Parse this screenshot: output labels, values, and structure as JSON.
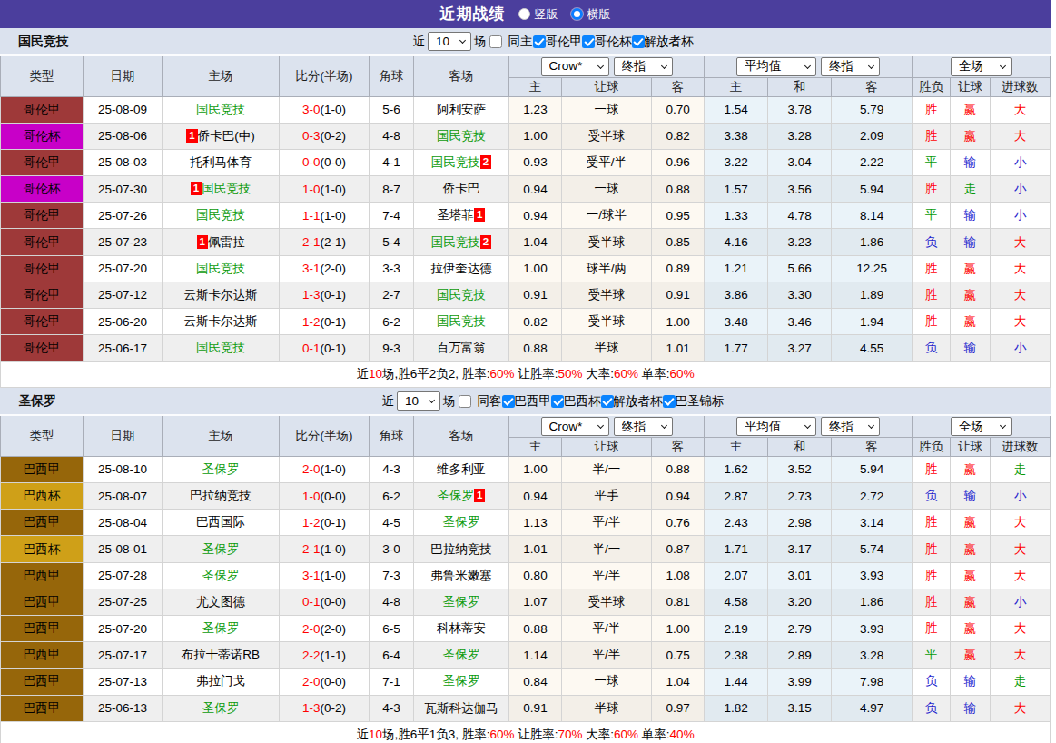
{
  "topbar": {
    "title": "近期战绩",
    "radios": [
      {
        "label": "竖版",
        "selected": false
      },
      {
        "label": "横版",
        "selected": true
      }
    ]
  },
  "columns": {
    "main": [
      "类型",
      "日期",
      "主场",
      "比分(半场)",
      "角球",
      "客场"
    ],
    "sub": [
      "主",
      "让球",
      "客",
      "主",
      "和",
      "客",
      "胜负",
      "让球",
      "进球数"
    ]
  },
  "league_colors": {
    "哥伦甲": "#9e3939",
    "哥伦杯": "#c800c8",
    "巴西甲": "#96660a",
    "巴西杯": "#cfa018"
  },
  "result_colors": {
    "胜": "res-r",
    "平": "res-g",
    "负": "res-b",
    "赢": "res-r",
    "走": "res-g",
    "输": "res-b",
    "大": "res-r",
    "小": "res-b"
  },
  "sections": [
    {
      "team": "国民竞技",
      "controls": {
        "recent_label": "近",
        "recent_value": "10",
        "games_label": "场",
        "same_label": "同主",
        "same_checked": false,
        "leagues": [
          {
            "label": "哥伦甲",
            "checked": true
          },
          {
            "label": "哥伦杯",
            "checked": true
          },
          {
            "label": "解放者杯",
            "checked": true
          }
        ]
      },
      "selects": {
        "odds_company": "Crow*",
        "odds_stage": "终指",
        "average": "平均值",
        "average_stage": "终指",
        "scope": "全场"
      },
      "rows": [
        {
          "league": "哥伦甲",
          "date": "25-08-09",
          "home": {
            "name": "国民竞技",
            "self": true,
            "badge": ""
          },
          "score": "3-0",
          "half": "(1-0)",
          "corner": "5-6",
          "away": {
            "name": "阿利安萨",
            "self": false,
            "badge": ""
          },
          "odds": [
            "1.23",
            "一球",
            "0.70"
          ],
          "avg": [
            "1.54",
            "3.78",
            "5.79"
          ],
          "results": [
            "胜",
            "赢",
            "大"
          ]
        },
        {
          "league": "哥伦杯",
          "date": "25-08-06",
          "home": {
            "name": "侨卡巴(中)",
            "self": false,
            "badge": "1"
          },
          "score": "0-3",
          "half": "(0-2)",
          "corner": "4-8",
          "away": {
            "name": "国民竞技",
            "self": true,
            "badge": ""
          },
          "odds": [
            "1.00",
            "受半球",
            "0.82"
          ],
          "avg": [
            "3.38",
            "3.28",
            "2.09"
          ],
          "results": [
            "胜",
            "赢",
            "大"
          ]
        },
        {
          "league": "哥伦甲",
          "date": "25-08-03",
          "home": {
            "name": "托利马体育",
            "self": false,
            "badge": ""
          },
          "score": "0-0",
          "half": "(0-0)",
          "corner": "4-1",
          "away": {
            "name": "国民竞技",
            "self": true,
            "badge": "2"
          },
          "odds": [
            "0.93",
            "受平/半",
            "0.96"
          ],
          "avg": [
            "3.22",
            "3.04",
            "2.22"
          ],
          "results": [
            "平",
            "输",
            "小"
          ]
        },
        {
          "league": "哥伦杯",
          "date": "25-07-30",
          "home": {
            "name": "国民竞技",
            "self": true,
            "badge": "1"
          },
          "score": "1-0",
          "half": "(1-0)",
          "corner": "8-7",
          "away": {
            "name": "侨卡巴",
            "self": false,
            "badge": ""
          },
          "odds": [
            "0.94",
            "一球",
            "0.88"
          ],
          "avg": [
            "1.57",
            "3.56",
            "5.94"
          ],
          "results": [
            "胜",
            "走",
            "小"
          ]
        },
        {
          "league": "哥伦甲",
          "date": "25-07-26",
          "home": {
            "name": "国民竞技",
            "self": true,
            "badge": ""
          },
          "score": "1-1",
          "half": "(1-0)",
          "corner": "7-4",
          "away": {
            "name": "圣塔菲",
            "self": false,
            "badge": "1"
          },
          "odds": [
            "0.94",
            "一/球半",
            "0.95"
          ],
          "avg": [
            "1.33",
            "4.78",
            "8.14"
          ],
          "results": [
            "平",
            "输",
            "小"
          ]
        },
        {
          "league": "哥伦甲",
          "date": "25-07-23",
          "home": {
            "name": "佩雷拉",
            "self": false,
            "badge": "1"
          },
          "score": "2-1",
          "half": "(2-1)",
          "corner": "5-4",
          "away": {
            "name": "国民竞技",
            "self": true,
            "badge": "2"
          },
          "odds": [
            "1.04",
            "受半球",
            "0.85"
          ],
          "avg": [
            "4.16",
            "3.23",
            "1.86"
          ],
          "results": [
            "负",
            "输",
            "大"
          ]
        },
        {
          "league": "哥伦甲",
          "date": "25-07-20",
          "home": {
            "name": "国民竞技",
            "self": true,
            "badge": ""
          },
          "score": "3-1",
          "half": "(2-0)",
          "corner": "3-3",
          "away": {
            "name": "拉伊奎达德",
            "self": false,
            "badge": ""
          },
          "odds": [
            "1.00",
            "球半/两",
            "0.89"
          ],
          "avg": [
            "1.21",
            "5.66",
            "12.25"
          ],
          "results": [
            "胜",
            "赢",
            "大"
          ]
        },
        {
          "league": "哥伦甲",
          "date": "25-07-12",
          "home": {
            "name": "云斯卡尔达斯",
            "self": false,
            "badge": ""
          },
          "score": "1-3",
          "half": "(0-1)",
          "corner": "2-7",
          "away": {
            "name": "国民竞技",
            "self": true,
            "badge": ""
          },
          "odds": [
            "0.91",
            "受半球",
            "0.91"
          ],
          "avg": [
            "3.86",
            "3.30",
            "1.89"
          ],
          "results": [
            "胜",
            "赢",
            "大"
          ]
        },
        {
          "league": "哥伦甲",
          "date": "25-06-20",
          "home": {
            "name": "云斯卡尔达斯",
            "self": false,
            "badge": ""
          },
          "score": "1-2",
          "half": "(0-1)",
          "corner": "6-2",
          "away": {
            "name": "国民竞技",
            "self": true,
            "badge": ""
          },
          "odds": [
            "0.82",
            "受半球",
            "1.00"
          ],
          "avg": [
            "3.48",
            "3.46",
            "1.94"
          ],
          "results": [
            "胜",
            "赢",
            "大"
          ]
        },
        {
          "league": "哥伦甲",
          "date": "25-06-17",
          "home": {
            "name": "国民竞技",
            "self": true,
            "badge": ""
          },
          "score": "0-1",
          "half": "(0-1)",
          "corner": "9-3",
          "away": {
            "name": "百万富翁",
            "self": false,
            "badge": ""
          },
          "odds": [
            "0.88",
            "半球",
            "1.01"
          ],
          "avg": [
            "1.77",
            "3.27",
            "4.55"
          ],
          "results": [
            "负",
            "输",
            "小"
          ]
        }
      ],
      "summary": [
        [
          "近",
          "k"
        ],
        [
          "10",
          "r"
        ],
        [
          "场,胜6平2负2, 胜率:",
          "k"
        ],
        [
          "60%",
          "r"
        ],
        [
          " 让胜率:",
          "k"
        ],
        [
          "50%",
          "r"
        ],
        [
          " 大率:",
          "k"
        ],
        [
          "60%",
          "r"
        ],
        [
          " 单率:",
          "k"
        ],
        [
          "60%",
          "r"
        ]
      ]
    },
    {
      "team": "圣保罗",
      "controls": {
        "recent_label": "近",
        "recent_value": "10",
        "games_label": "场",
        "same_label": "同客",
        "same_checked": false,
        "leagues": [
          {
            "label": "巴西甲",
            "checked": true
          },
          {
            "label": "巴西杯",
            "checked": true
          },
          {
            "label": "解放者杯",
            "checked": true
          },
          {
            "label": "巴圣锦标",
            "checked": true
          }
        ]
      },
      "selects": {
        "odds_company": "Crow*",
        "odds_stage": "终指",
        "average": "平均值",
        "average_stage": "终指",
        "scope": "全场"
      },
      "rows": [
        {
          "league": "巴西甲",
          "date": "25-08-10",
          "home": {
            "name": "圣保罗",
            "self": true,
            "badge": ""
          },
          "score": "2-0",
          "half": "(1-0)",
          "corner": "4-3",
          "away": {
            "name": "维多利亚",
            "self": false,
            "badge": ""
          },
          "odds": [
            "1.00",
            "半/一",
            "0.88"
          ],
          "avg": [
            "1.62",
            "3.52",
            "5.94"
          ],
          "results": [
            "胜",
            "赢",
            "走"
          ]
        },
        {
          "league": "巴西杯",
          "date": "25-08-07",
          "home": {
            "name": "巴拉纳竞技",
            "self": false,
            "badge": ""
          },
          "score": "1-0",
          "half": "(0-0)",
          "corner": "6-2",
          "away": {
            "name": "圣保罗",
            "self": true,
            "badge": "1"
          },
          "odds": [
            "0.94",
            "平手",
            "0.94"
          ],
          "avg": [
            "2.87",
            "2.73",
            "2.72"
          ],
          "results": [
            "负",
            "输",
            "小"
          ]
        },
        {
          "league": "巴西甲",
          "date": "25-08-04",
          "home": {
            "name": "巴西国际",
            "self": false,
            "badge": ""
          },
          "score": "1-2",
          "half": "(0-1)",
          "corner": "4-5",
          "away": {
            "name": "圣保罗",
            "self": true,
            "badge": ""
          },
          "odds": [
            "1.13",
            "平/半",
            "0.76"
          ],
          "avg": [
            "2.43",
            "2.98",
            "3.14"
          ],
          "results": [
            "胜",
            "赢",
            "大"
          ]
        },
        {
          "league": "巴西杯",
          "date": "25-08-01",
          "home": {
            "name": "圣保罗",
            "self": true,
            "badge": ""
          },
          "score": "2-1",
          "half": "(1-0)",
          "corner": "3-0",
          "away": {
            "name": "巴拉纳竞技",
            "self": false,
            "badge": ""
          },
          "odds": [
            "1.01",
            "半/一",
            "0.87"
          ],
          "avg": [
            "1.71",
            "3.17",
            "5.74"
          ],
          "results": [
            "胜",
            "赢",
            "大"
          ]
        },
        {
          "league": "巴西甲",
          "date": "25-07-28",
          "home": {
            "name": "圣保罗",
            "self": true,
            "badge": ""
          },
          "score": "3-1",
          "half": "(1-0)",
          "corner": "7-3",
          "away": {
            "name": "弗鲁米嫩塞",
            "self": false,
            "badge": ""
          },
          "odds": [
            "0.80",
            "平/半",
            "1.08"
          ],
          "avg": [
            "2.07",
            "3.01",
            "3.93"
          ],
          "results": [
            "胜",
            "赢",
            "大"
          ]
        },
        {
          "league": "巴西甲",
          "date": "25-07-25",
          "home": {
            "name": "尤文图德",
            "self": false,
            "badge": ""
          },
          "score": "0-1",
          "half": "(0-0)",
          "corner": "4-8",
          "away": {
            "name": "圣保罗",
            "self": true,
            "badge": ""
          },
          "odds": [
            "1.07",
            "受半球",
            "0.81"
          ],
          "avg": [
            "4.58",
            "3.20",
            "1.86"
          ],
          "results": [
            "胜",
            "赢",
            "小"
          ]
        },
        {
          "league": "巴西甲",
          "date": "25-07-20",
          "home": {
            "name": "圣保罗",
            "self": true,
            "badge": ""
          },
          "score": "2-0",
          "half": "(2-0)",
          "corner": "6-5",
          "away": {
            "name": "科林蒂安",
            "self": false,
            "badge": ""
          },
          "odds": [
            "0.88",
            "平/半",
            "1.00"
          ],
          "avg": [
            "2.19",
            "2.79",
            "3.93"
          ],
          "results": [
            "胜",
            "赢",
            "大"
          ]
        },
        {
          "league": "巴西甲",
          "date": "25-07-17",
          "home": {
            "name": "布拉干蒂诺RB",
            "self": false,
            "badge": ""
          },
          "score": "2-2",
          "half": "(1-1)",
          "corner": "6-4",
          "away": {
            "name": "圣保罗",
            "self": true,
            "badge": ""
          },
          "odds": [
            "1.14",
            "平/半",
            "0.75"
          ],
          "avg": [
            "2.38",
            "2.89",
            "3.28"
          ],
          "results": [
            "平",
            "赢",
            "大"
          ]
        },
        {
          "league": "巴西甲",
          "date": "25-07-13",
          "home": {
            "name": "弗拉门戈",
            "self": false,
            "badge": ""
          },
          "score": "2-0",
          "half": "(0-0)",
          "corner": "7-1",
          "away": {
            "name": "圣保罗",
            "self": true,
            "badge": ""
          },
          "odds": [
            "0.84",
            "一球",
            "1.04"
          ],
          "avg": [
            "1.44",
            "3.99",
            "7.98"
          ],
          "results": [
            "负",
            "输",
            "走"
          ]
        },
        {
          "league": "巴西甲",
          "date": "25-06-13",
          "home": {
            "name": "圣保罗",
            "self": true,
            "badge": ""
          },
          "score": "1-3",
          "half": "(0-2)",
          "corner": "4-3",
          "away": {
            "name": "瓦斯科达伽马",
            "self": false,
            "badge": ""
          },
          "odds": [
            "0.91",
            "半球",
            "0.97"
          ],
          "avg": [
            "1.82",
            "3.15",
            "4.97"
          ],
          "results": [
            "负",
            "输",
            "大"
          ]
        }
      ],
      "summary": [
        [
          "近",
          "k"
        ],
        [
          "10",
          "r"
        ],
        [
          "场,胜6平1负3, 胜率:",
          "k"
        ],
        [
          "60%",
          "r"
        ],
        [
          " 让胜率:",
          "k"
        ],
        [
          "70%",
          "r"
        ],
        [
          " 大率:",
          "k"
        ],
        [
          "60%",
          "r"
        ],
        [
          " 单率:",
          "k"
        ],
        [
          "40%",
          "r"
        ]
      ]
    }
  ]
}
